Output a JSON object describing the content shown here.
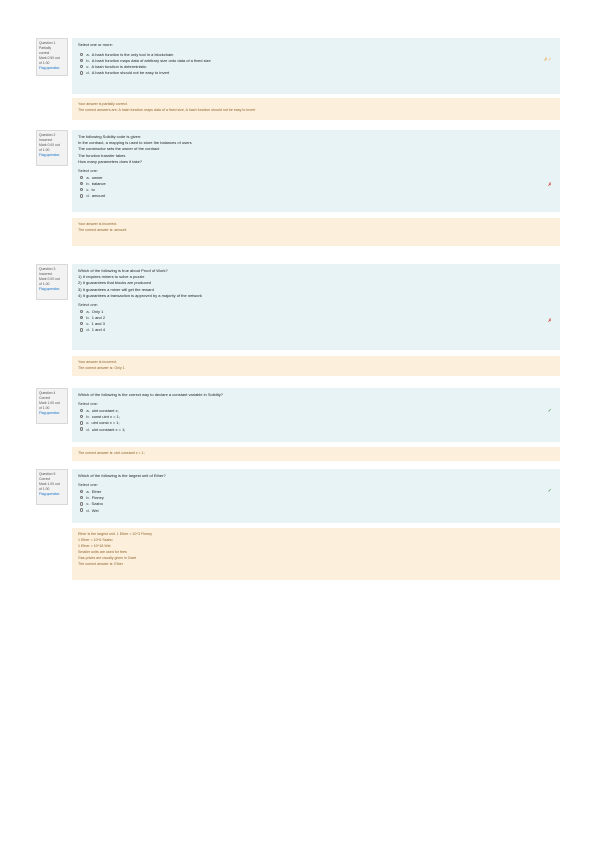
{
  "questions": [
    {
      "info": [
        "Question 1",
        "Partially",
        "correct",
        "Mark 0.50 out",
        "of 1.00",
        "Flag question"
      ],
      "text": [
        "Select one or more:"
      ],
      "prompt": "",
      "options": [
        {
          "letter": "a.",
          "text": "A hash function is the only tool in a blockchain",
          "selected": false
        },
        {
          "letter": "b.",
          "text": "A hash function maps data of arbitrary size onto data of a fixed size",
          "selected": true
        },
        {
          "letter": "c.",
          "text": "A hash function is deterministic",
          "selected": false
        },
        {
          "letter": "d.",
          "text": "A hash function should not be easy to invert",
          "selected": false
        }
      ],
      "mark": "✗✓",
      "feedback": [
        "Your answer is partially correct.",
        "The correct answers are: A hash function maps data of a fixed size, A hash function should not be easy to invert"
      ]
    },
    {
      "info": [
        "Question 2",
        "Incorrect",
        "Mark 0.00 out",
        "of 1.00",
        "Flag question"
      ],
      "text": [
        "The following Solidity code is given:",
        "In the contract, a mapping is used to store the balances of users",
        "The constructor sets the owner of the contract",
        "The function transfer takes",
        "How many parameters does it take?"
      ],
      "prompt": "Select one:",
      "options": [
        {
          "letter": "a.",
          "text": "owner",
          "selected": false
        },
        {
          "letter": "b.",
          "text": "balance",
          "selected": true
        },
        {
          "letter": "c.",
          "text": "to",
          "selected": false
        },
        {
          "letter": "d.",
          "text": "amount",
          "selected": false
        }
      ],
      "mark": "✗",
      "feedback": [
        "Your answer is incorrect.",
        "The correct answer is: amount"
      ]
    },
    {
      "info": [
        "Question 3",
        "Incorrect",
        "Mark 0.00 out",
        "of 1.00",
        "Flag question"
      ],
      "text": [
        "Which of the following is true about Proof of Work?",
        "1) It requires miners to solve a puzzle",
        "2) It guarantees that blocks are produced",
        "3) It guarantees a miner will get the reward",
        "4) It guarantees a transaction is approved by a majority of the network"
      ],
      "prompt": "Select one:",
      "options": [
        {
          "letter": "a.",
          "text": "Only 1",
          "selected": false
        },
        {
          "letter": "b.",
          "text": "1 and 2",
          "selected": true
        },
        {
          "letter": "c.",
          "text": "1 and 3",
          "selected": false
        },
        {
          "letter": "d.",
          "text": "1 and 4",
          "selected": false
        }
      ],
      "mark": "✗",
      "feedback": [
        "Your answer is incorrect.",
        "The correct answer is: Only 1"
      ]
    },
    {
      "info": [
        "Question 4",
        "Correct",
        "Mark 1.00 out",
        "of 1.00",
        "Flag question"
      ],
      "text": [
        "Which of the following is the correct way to declare a constant variable in Solidity?"
      ],
      "prompt": "Select one:",
      "options": [
        {
          "letter": "a.",
          "text": "uint constant x;",
          "selected": false
        },
        {
          "letter": "b.",
          "text": "const uint x = 1;",
          "selected": false
        },
        {
          "letter": "c.",
          "text": "uint const x = 1;",
          "selected": false
        },
        {
          "letter": "d.",
          "text": "uint constant x = 1;",
          "selected": true
        }
      ],
      "mark": "✓",
      "feedback": [
        "The correct answer is: uint constant x = 1;"
      ]
    },
    {
      "info": [
        "Question 5",
        "Correct",
        "Mark 1.00 out",
        "of 1.00",
        "Flag question"
      ],
      "text": [
        "Which of the following is the largest unit of Ether?"
      ],
      "prompt": "Select one:",
      "options": [
        {
          "letter": "a.",
          "text": "Ether",
          "selected": true
        },
        {
          "letter": "b.",
          "text": "Finney",
          "selected": false
        },
        {
          "letter": "c.",
          "text": "Szabo",
          "selected": false
        },
        {
          "letter": "d.",
          "text": "Wei",
          "selected": false
        }
      ],
      "mark": "✓",
      "feedback": [
        "Ether is the largest unit. 1 Ether = 10^3 Finney",
        "1 Ether = 10^6 Szabo",
        "1 Ether = 10^18 Wei",
        "Smaller units are used for fees",
        "Gas prices are usually given in Gwei",
        "The correct answer is: Ether"
      ]
    }
  ]
}
